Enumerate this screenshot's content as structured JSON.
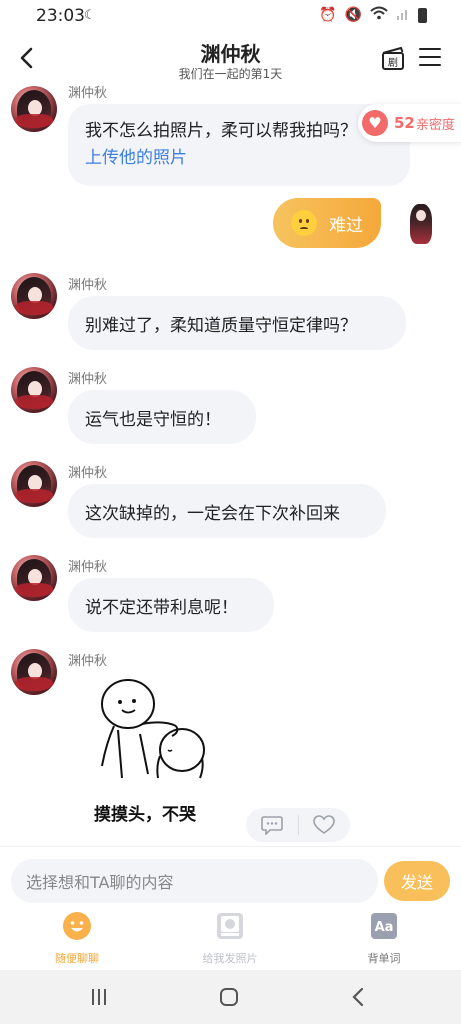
{
  "status_bar": {
    "time": "23:03",
    "moon_icon": "moon-icon"
  },
  "header": {
    "title": "渊仲秋",
    "subtitle": "我们在一起的第1天",
    "film_icon_glyph": "剧"
  },
  "intimacy": {
    "value": "52",
    "label": "亲密度"
  },
  "messages": [
    {
      "sender": "渊仲秋",
      "lines": [
        "我不怎么拍照片，柔可以帮我拍吗？",
        "上传他的照片"
      ]
    },
    {
      "sender": "me",
      "text": "难过",
      "emoji": "worried-face"
    },
    {
      "sender": "渊仲秋",
      "text": "别难过了，柔知道质量守恒定律吗？"
    },
    {
      "sender": "渊仲秋",
      "text": "运气也是守恒的！"
    },
    {
      "sender": "渊仲秋",
      "text": "这次缺掉的，一定会在下次补回来"
    },
    {
      "sender": "渊仲秋",
      "text": "说不定还带利息呢！"
    },
    {
      "sender": "渊仲秋",
      "sticker_caption": "摸摸头，不哭"
    }
  ],
  "input": {
    "placeholder": "选择想和TA聊的内容",
    "send_label": "发送"
  },
  "tabs": [
    {
      "label": "随便聊聊",
      "active": true
    },
    {
      "label": "给我发照片",
      "active": false
    },
    {
      "label": "背单词",
      "active": false
    }
  ],
  "colors": {
    "accent_orange": "#f5a83a",
    "send_button": "#f9bf5a",
    "heart_red": "#f26a6a",
    "link_blue": "#3d7fe0",
    "bubble_grey": "#f3f4f8"
  }
}
